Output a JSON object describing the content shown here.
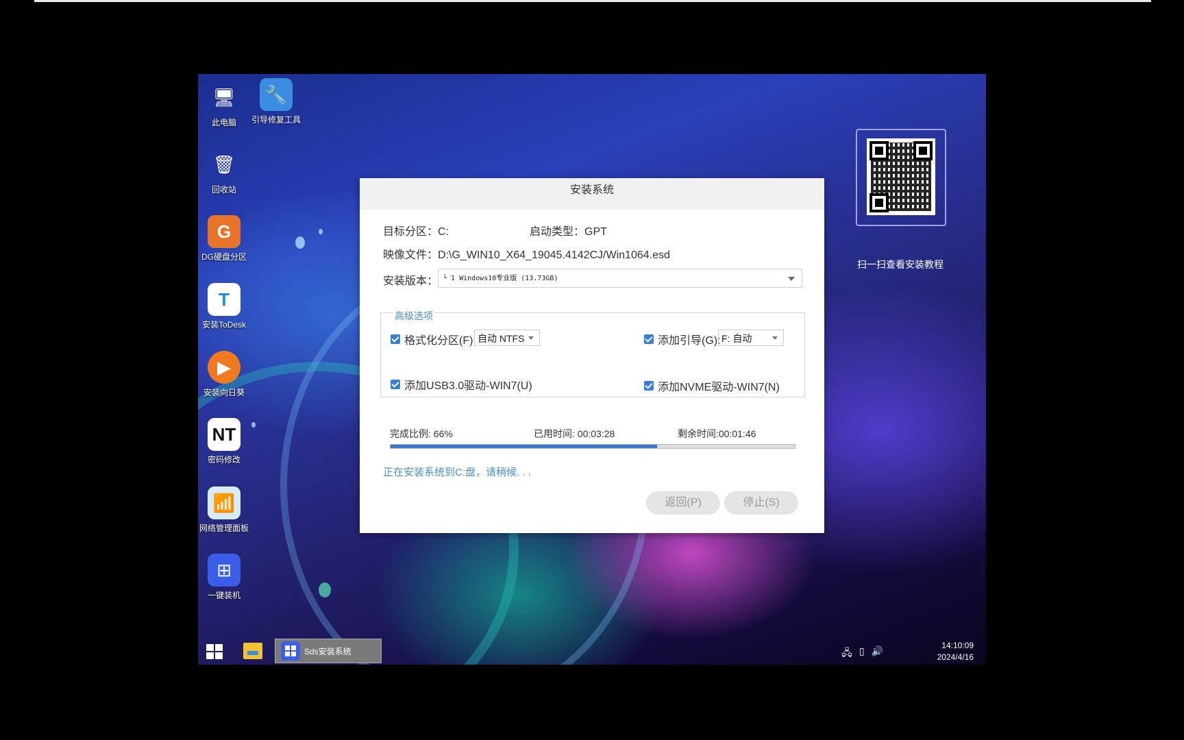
{
  "desktop": {
    "icons": [
      {
        "label": "此电脑",
        "glyph": "🖥",
        "color": "#5da8e8"
      },
      {
        "label": "引导修复工具",
        "glyph": "🔧",
        "color": "#3a8de0"
      },
      {
        "label": "回收站",
        "glyph": "🗑",
        "color": "#8fb5d8"
      },
      {
        "label": "DG硬盘分区",
        "glyph": "G",
        "color": "#e8742a"
      },
      {
        "label": "安装ToDesk",
        "glyph": "T",
        "color": "#ffffff"
      },
      {
        "label": "安装向日葵",
        "glyph": "▶",
        "color": "#f07a20"
      },
      {
        "label": "密码修改",
        "glyph": "NT",
        "color": "#222222"
      },
      {
        "label": "网络管理面板",
        "glyph": "📶",
        "color": "#2f6fb0"
      },
      {
        "label": "一键装机",
        "glyph": "⊞",
        "color": "#3b5ee8"
      }
    ],
    "qr_caption": "扫一扫查看安装教程"
  },
  "dialog": {
    "title": "安装系统",
    "target_label": "目标分区：C:",
    "boot_label": "启动类型：GPT",
    "image_label": "映像文件：D:\\G_WIN10_X64_19045.4142CJ/Win1064.esd",
    "version_label": "安装版本：",
    "version_value": "└ 1 Windows10专业版 (13.73GB)",
    "advanced": {
      "legend": "高级选项",
      "format_label": "格式化分区(F)",
      "format_value": "自动 NTFS",
      "boot_add_label": "添加引导(G):",
      "boot_add_value": "F: 自动",
      "usb3_label": "添加USB3.0驱动-WIN7(U)",
      "nvme_label": "添加NVME驱动-WIN7(N)"
    },
    "progress": {
      "percent_label": "完成比例: 66%",
      "elapsed_label": "已用时间: 00:03:28",
      "remaining_label": "剩余时间:00:01:46",
      "fraction": 0.66
    },
    "status": "正在安装系统到C:盘，请稍候. . .",
    "back_button": "返回(P)",
    "stop_button": "停止(S)"
  },
  "taskbar": {
    "app_label": "Sds安装系统",
    "tray_icons": [
      "network-icon",
      "usb-icon",
      "volume-icon"
    ],
    "time": "14:10:09",
    "date": "2024/4/16"
  }
}
